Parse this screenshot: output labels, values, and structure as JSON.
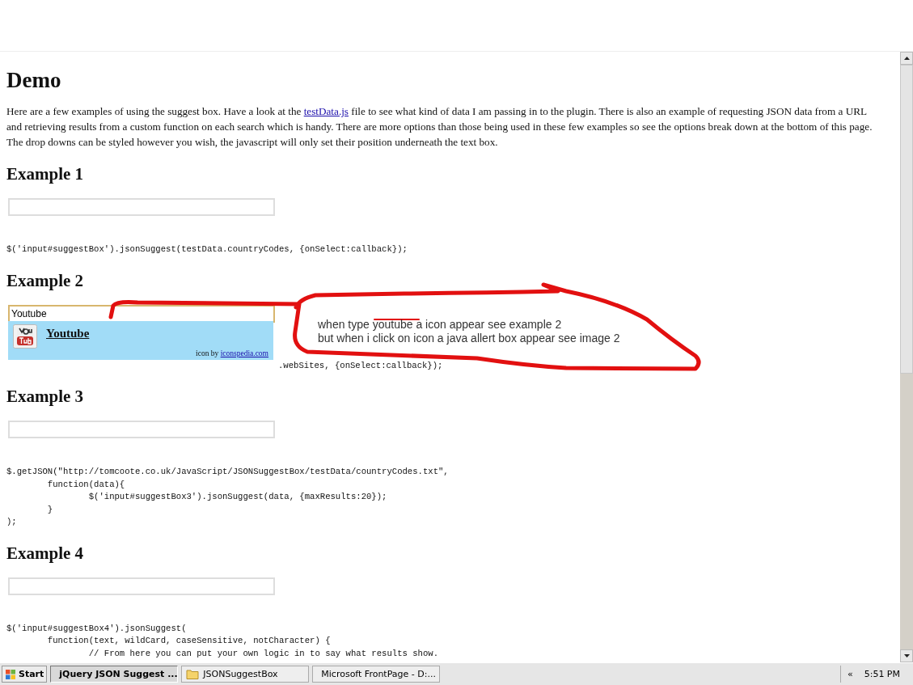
{
  "page": {
    "heading": "Demo",
    "intro": {
      "before": "Here are a few examples of using the suggest box. Have a look at the ",
      "link": "testData.js",
      "after": " file to see what kind of data I am passing in to the plugin. There is also an example of requesting JSON data from a URL and retrieving results from a custom function on each search which is handy. There are more options than those being used in these few examples so see the options break down at the bottom of this page. The drop downs can be styled however you wish, the javascript will only set their position underneath the text box."
    },
    "examples": [
      {
        "title": "Example 1",
        "focused": false,
        "code": [
          "$('input#suggestBox').jsonSuggest(testData.countryCodes, {onSelect:callback});"
        ]
      },
      {
        "title": "Example 2",
        "focused": true,
        "value": "Youtube",
        "suggestions": [
          {
            "label": "Youtube",
            "credit": "icon by ",
            "credit_link": "iconspedia.com"
          }
        ],
        "code": [
          ".webSites, {onSelect:callback});"
        ]
      },
      {
        "title": "Example 3",
        "focused": false,
        "code": [
          "$.getJSON(\"http://tomcoote.co.uk/JavaScript/JSONSuggestBox/testData/countryCodes.txt\",",
          "        function(data){",
          "                $('input#suggestBox3').jsonSuggest(data, {maxResults:20});",
          "        }",
          ");"
        ]
      },
      {
        "title": "Example 4",
        "focused": false,
        "code": [
          "$('input#suggestBox4').jsonSuggest(",
          "        function(text, wildCard, caseSensitive, notCharacter) {",
          "                // From here you can put your own logic in to say what results show."
        ]
      }
    ]
  },
  "annotation": [
    "when type youtube a icon appear see example 2",
    "but when i click on icon a java allert box appear see image 2"
  ],
  "taskbar": {
    "start": "Start",
    "tasks": [
      {
        "label": "jQuery JSON Suggest ...",
        "kind": "browser",
        "selected": true
      },
      {
        "label": "JSONSuggestBox",
        "kind": "folder",
        "selected": false
      },
      {
        "label": "Microsoft FrontPage - D:...",
        "kind": "app",
        "selected": false
      }
    ],
    "tray_toggle": "«",
    "clock": "5:51 PM"
  }
}
